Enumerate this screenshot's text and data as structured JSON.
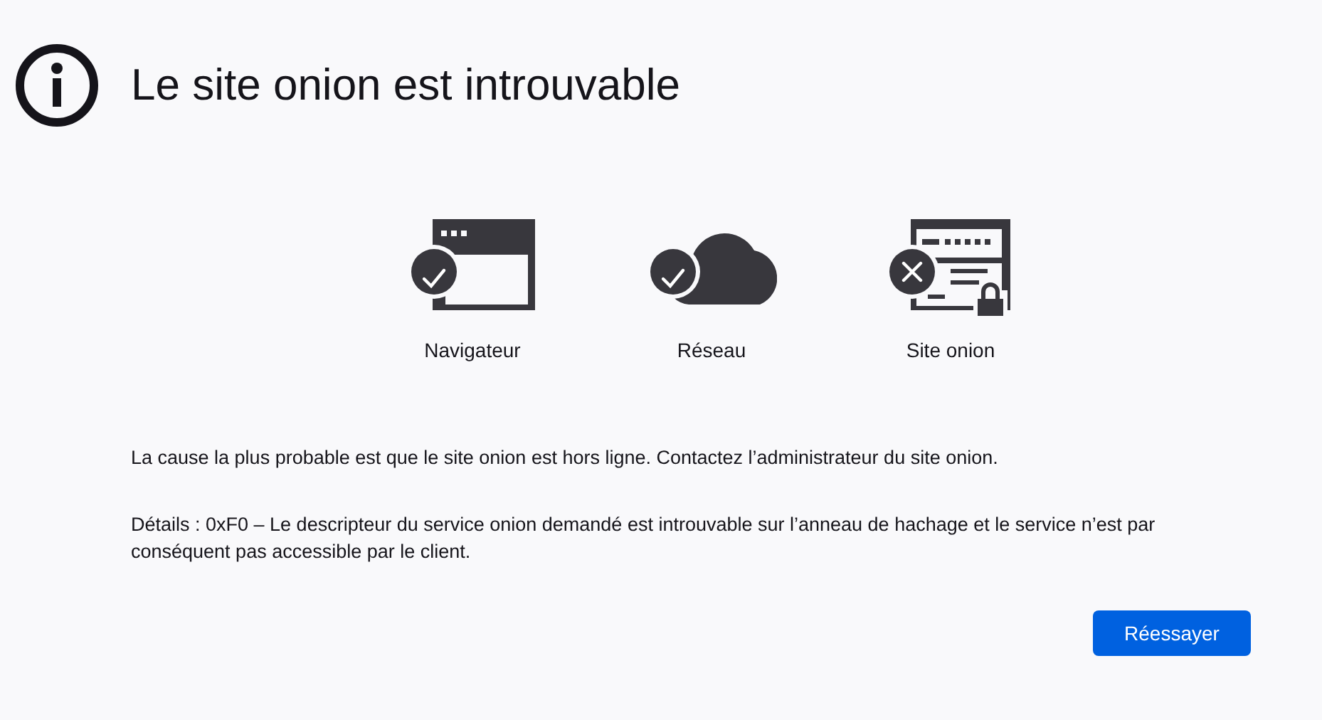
{
  "title": "Le site onion est introuvable",
  "checks": [
    {
      "kind": "browser",
      "passed": true,
      "label": "Navigateur"
    },
    {
      "kind": "network",
      "passed": true,
      "label": "Réseau"
    },
    {
      "kind": "site",
      "passed": false,
      "label": "Site onion"
    }
  ],
  "paragraphs": [
    "La cause la plus probable est que le site onion est hors ligne. Contactez l’administrateur du site onion.",
    "Détails : 0xF0 – Le descripteur du service onion demandé est introuvable sur l’anneau de hachage et le service n’est par conséquent pas accessible par le client."
  ],
  "button": "Réessayer"
}
